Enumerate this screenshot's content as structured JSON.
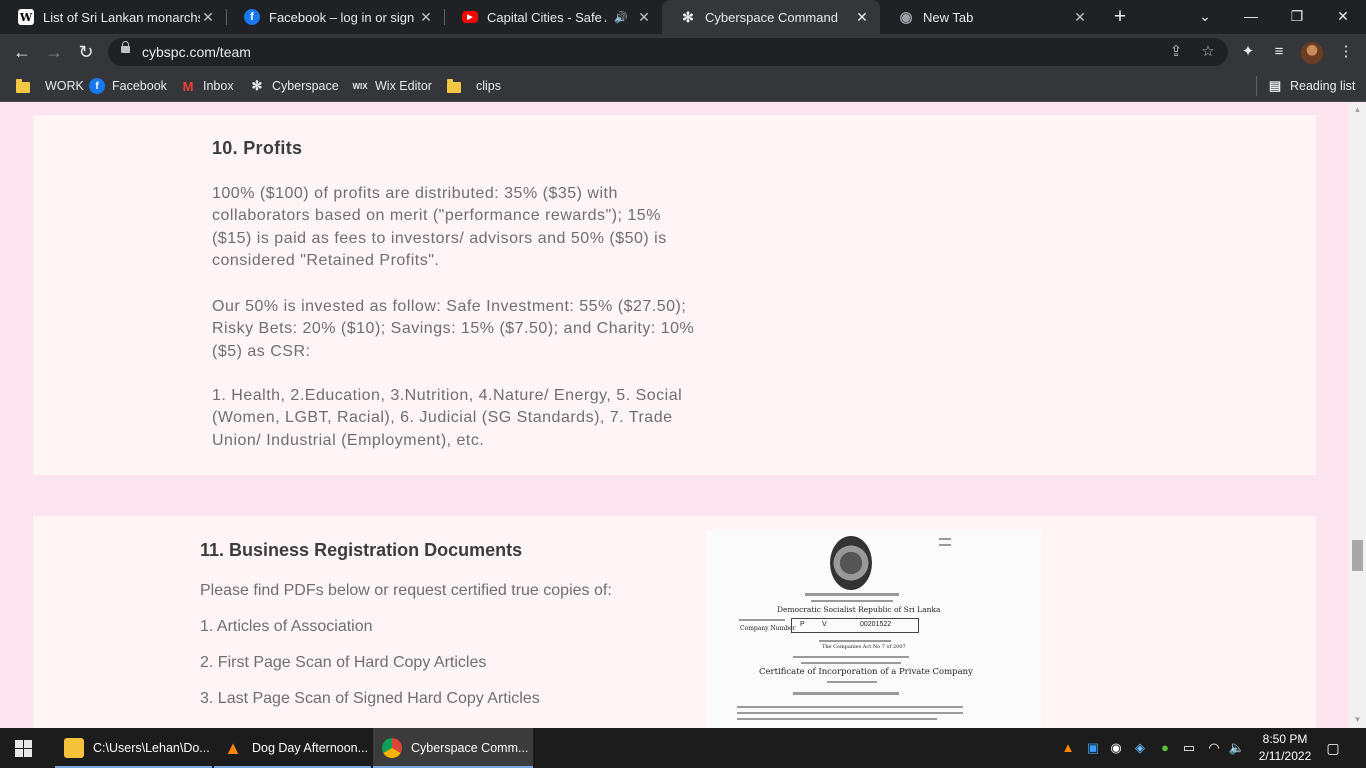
{
  "browser": {
    "tabs": [
      {
        "title": "List of Sri Lankan monarchs -",
        "favicon": "W"
      },
      {
        "title": "Facebook – log in or sign up",
        "favicon": "f"
      },
      {
        "title": "Capital Cities - Safe And",
        "favicon": "▶"
      },
      {
        "title": "Cyberspace Command",
        "favicon": "✻"
      },
      {
        "title": "New Tab",
        "favicon": "◉"
      }
    ],
    "new_tab_symbol": "+",
    "controls": {
      "menu": "⌄",
      "minimize": "—",
      "restore": "❐",
      "close": "✕"
    },
    "url": "cybspc.com/team",
    "bookmarks": [
      {
        "label": "WORK",
        "icon": "folder-icon"
      },
      {
        "label": "Facebook",
        "icon": "facebook-icon"
      },
      {
        "label": "Inbox",
        "icon": "gmail-icon"
      },
      {
        "label": "Cyberspace",
        "icon": "cyberspace-icon"
      },
      {
        "label": "Wix Editor",
        "icon": "wix-icon"
      },
      {
        "label": "clips",
        "icon": "folder-icon"
      }
    ],
    "reading_list": "Reading list"
  },
  "page": {
    "profits": {
      "heading": "10. Profits",
      "paragraph1": "100% ($100) of profits are distributed: 35% ($35) with collaborators based on merit (\"performance rewards\"); 15% ($15) is paid as fees to investors/ advisors and 50% ($50) is considered \"Retained Profits\".",
      "paragraph2": "Our 50% is invested as follow: Safe Investment: 55% ($27.50); Risky Bets: 20% ($10); Savings: 15% ($7.50); and Charity: 10% ($5) as CSR:",
      "paragraph3": "1. Health, 2.Education, 3.Nutrition, 4.Nature/ Energy, 5. Social (Women, LGBT, Racial), 6. Judicial (SG Standards), 7. Trade Union/ Industrial (Employment), etc."
    },
    "registration": {
      "heading": "11. Business Registration Documents",
      "intro": "Please find PDFs below or request certified true copies of:",
      "items": [
        "1. Articles of Association",
        "2. First Page Scan of Hard Copy Articles",
        "3. Last Page Scan of Signed Hard Copy Articles"
      ],
      "certificate": {
        "republic_line": "Democratic Socialist Republic of Sri Lanka",
        "company_number_label": "Company Number",
        "number_prefix_1": "P",
        "number_prefix_2": "V",
        "number": "00201522",
        "act_line": "The Companies Act No 7 of 2007",
        "title": "Certificate of Incorporation of a Private Company"
      }
    }
  },
  "taskbar": {
    "items": [
      {
        "label": "C:\\Users\\Lehan\\Do...",
        "icon": "file-explorer-icon"
      },
      {
        "label": "Dog Day Afternoon...",
        "icon": "vlc-icon"
      },
      {
        "label": "Cyberspace Comm...",
        "icon": "chrome-icon"
      }
    ],
    "time": "8:50 PM",
    "date": "2/11/2022"
  }
}
